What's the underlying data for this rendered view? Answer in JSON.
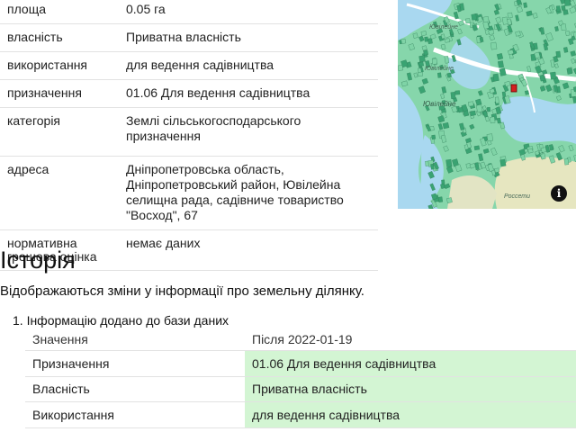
{
  "properties": [
    {
      "key": "площа",
      "value": "0.05 га"
    },
    {
      "key": "власність",
      "value": "Приватна власність"
    },
    {
      "key": "використання",
      "value": "для ведення садівництва"
    },
    {
      "key": "призначення",
      "value": "01.06 Для ведення садівництва"
    },
    {
      "key": "категорія",
      "value": "Землі сільськогосподарського призначення"
    },
    {
      "key": "адреса",
      "value": "Дніпропетровська область, Дніпропетровський район, Ювілейна селищна рада, садівниче товариство \"Восход\", 67"
    },
    {
      "key": "нормативна грошова оцінка",
      "value": "немає даних"
    }
  ],
  "map": {
    "labels": [
      "Ювілейне",
      "Ювілейне",
      "Россети",
      "Ювілейне"
    ],
    "info_icon": "info-icon",
    "colors": {
      "water": "#a9d8f0",
      "parcels": "#3aa372",
      "parcels_light": "#7fd3a6",
      "selected": "#d42020"
    }
  },
  "history": {
    "title": "Історія",
    "description": "Відображаються зміни у інформації про земельну ділянку.",
    "item_label": "1. Інформацію додано до бази даних",
    "header": {
      "key": "Значення",
      "value": "Після 2022-01-19"
    },
    "rows": [
      {
        "key": "Призначення",
        "value": "01.06 Для ведення садівництва"
      },
      {
        "key": "Власність",
        "value": "Приватна власність"
      },
      {
        "key": "Використання",
        "value": "для ведення садівництва"
      }
    ],
    "highlight_color": "#d3f5d3"
  }
}
